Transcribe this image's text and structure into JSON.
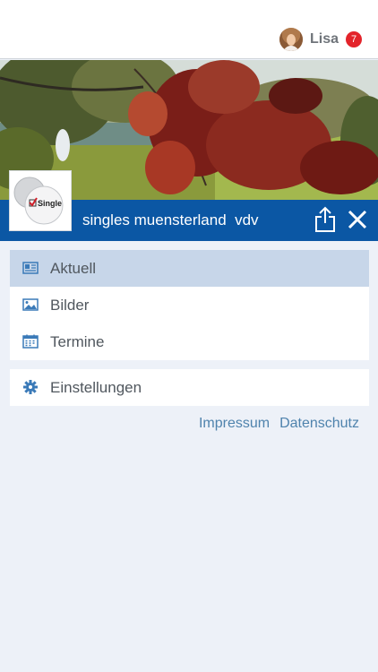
{
  "user": {
    "name": "Lisa",
    "notifications": "7"
  },
  "club": {
    "title": "singles muensterland  vdv",
    "logo_text": "Single"
  },
  "menu": [
    {
      "label": "Aktuell",
      "icon": "newspaper-icon",
      "active": true
    },
    {
      "label": "Bilder",
      "icon": "image-icon",
      "active": false
    },
    {
      "label": "Termine",
      "icon": "calendar-icon",
      "active": false
    }
  ],
  "settings": {
    "label": "Einstellungen",
    "icon": "gear-icon"
  },
  "footer": {
    "impressum": "Impressum",
    "datenschutz": "Datenschutz"
  },
  "colors": {
    "brand": "#0b57a4",
    "active_item": "#c7d6e9",
    "link": "#4f83ad",
    "badge": "#e3232a"
  }
}
